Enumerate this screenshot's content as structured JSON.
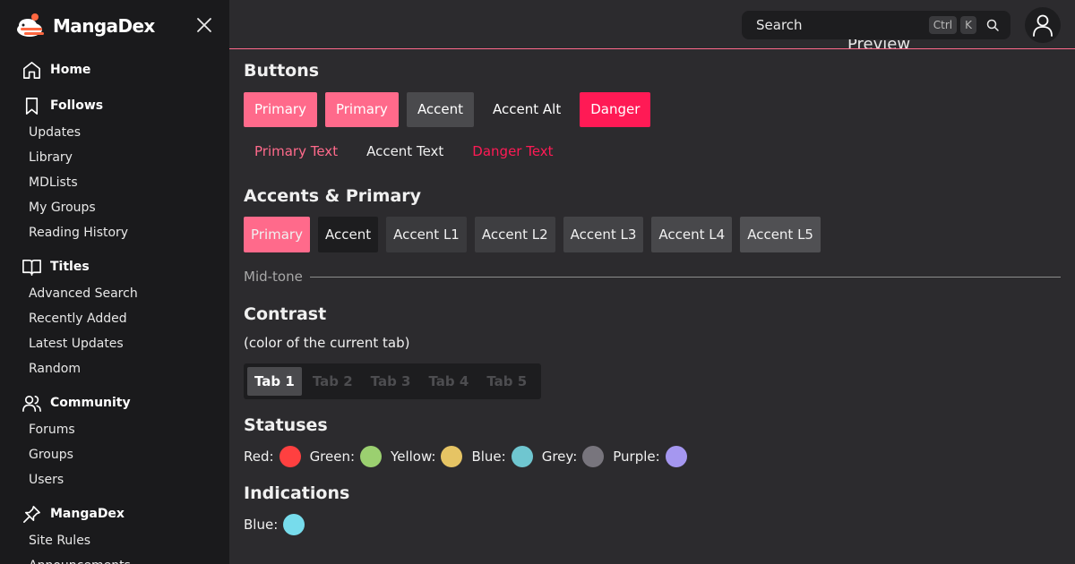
{
  "brand": {
    "name": "MangaDex"
  },
  "nav": [
    {
      "head": "Home",
      "icon": "home-icon",
      "items": []
    },
    {
      "head": "Follows",
      "icon": "bookmark-icon",
      "items": [
        "Updates",
        "Library",
        "MDLists",
        "My Groups",
        "Reading History"
      ]
    },
    {
      "head": "Titles",
      "icon": "book-open-icon",
      "items": [
        "Advanced Search",
        "Recently Added",
        "Latest Updates",
        "Random"
      ]
    },
    {
      "head": "Community",
      "icon": "users-icon",
      "items": [
        "Forums",
        "Groups",
        "Users"
      ]
    },
    {
      "head": "MangaDex",
      "icon": "pin-icon",
      "items": [
        "Site Rules",
        "Announcements"
      ]
    }
  ],
  "header": {
    "search_placeholder": "Search",
    "kbd_ctrl": "Ctrl",
    "kbd_k": "K",
    "preview_label": "Preview"
  },
  "sections": {
    "buttons": "Buttons",
    "accents": "Accents & Primary",
    "midtone": "Mid-tone",
    "contrast": "Contrast",
    "contrast_sub": "(color of the current tab)",
    "statuses": "Statuses",
    "indications": "Indications"
  },
  "buttons": [
    "Primary",
    "Primary",
    "Accent",
    "Accent Alt",
    "Danger"
  ],
  "text_buttons": [
    "Primary Text",
    "Accent Text",
    "Danger Text"
  ],
  "swatches": [
    "Primary",
    "Accent",
    "Accent L1",
    "Accent L2",
    "Accent L3",
    "Accent L4",
    "Accent L5"
  ],
  "tabs": [
    "Tab 1",
    "Tab 2",
    "Tab 3",
    "Tab 4",
    "Tab 5"
  ],
  "statuses": [
    {
      "label": "Red:",
      "color": "#ff4040"
    },
    {
      "label": "Green:",
      "color": "#9bd070"
    },
    {
      "label": "Yellow:",
      "color": "#e6c464"
    },
    {
      "label": "Blue:",
      "color": "#6fc6d0"
    },
    {
      "label": "Grey:",
      "color": "#78757d"
    },
    {
      "label": "Purple:",
      "color": "#a597f0"
    }
  ],
  "indications": [
    {
      "label": "Blue:",
      "color": "#77dcec"
    }
  ],
  "colors": {
    "primary": "#ff6a8b",
    "danger": "#ff1a55",
    "accent": "#4a4a4d",
    "accent_l1": "#3a3a3d",
    "accent_l2": "#3e3e41",
    "accent_l3": "#434346",
    "accent_l4": "#48484b",
    "accent_l5": "#505053"
  }
}
